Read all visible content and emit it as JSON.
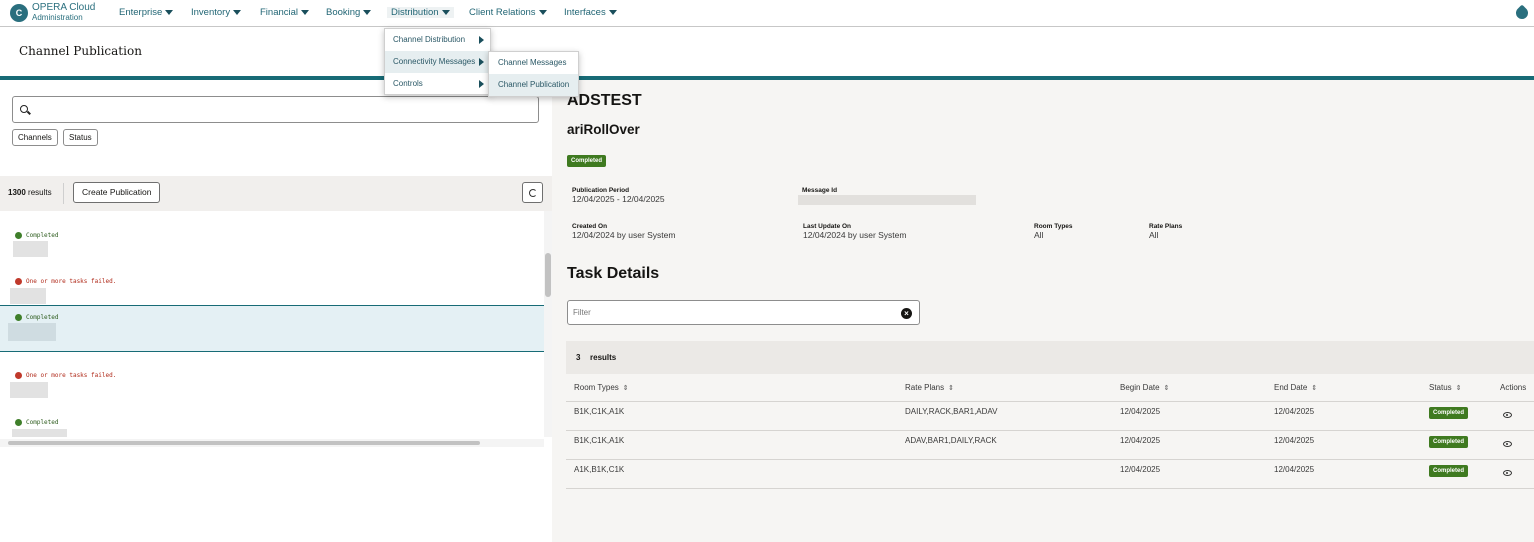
{
  "brand": {
    "line1": "OPERA Cloud",
    "line2": "Administration"
  },
  "nav": [
    {
      "label": "Enterprise"
    },
    {
      "label": "Inventory"
    },
    {
      "label": "Financial"
    },
    {
      "label": "Booking"
    },
    {
      "label": "Distribution"
    },
    {
      "label": "Client Relations"
    },
    {
      "label": "Interfaces"
    }
  ],
  "menu_distribution": [
    "Channel Distribution",
    "Connectivity Messages",
    "Controls"
  ],
  "menu_connectivity": [
    "Channel Messages",
    "Channel Publication"
  ],
  "page_title": "Channel Publication",
  "left": {
    "chips": [
      "Channels",
      "Status"
    ],
    "results_count": "1300",
    "results_label": "results",
    "create_button": "Create Publication",
    "items": [
      {
        "status": "Completed",
        "state": "ok"
      },
      {
        "status": "One or more tasks failed.",
        "state": "err"
      },
      {
        "status": "Completed",
        "state": "ok"
      },
      {
        "status": "One or more tasks failed.",
        "state": "err"
      },
      {
        "status": "Completed",
        "state": "ok"
      }
    ]
  },
  "detail": {
    "title": "ADSTEST",
    "subtitle": "ariRollOver",
    "status": "Completed",
    "publication_period_label": "Publication Period",
    "publication_period": "12/04/2025 - 12/04/2025",
    "message_id_label": "Message Id",
    "created_on_label": "Created On",
    "created_on": "12/04/2024 by user System",
    "last_update_label": "Last Update On",
    "last_update": "12/04/2024 by user System",
    "room_types_label": "Room Types",
    "room_types": "All",
    "rate_plans_label": "Rate Plans",
    "rate_plans": "All"
  },
  "tasks": {
    "heading": "Task Details",
    "filter_placeholder": "Filter",
    "count": "3",
    "results_label": "results",
    "columns": [
      "Room Types",
      "Rate Plans",
      "Begin Date",
      "End Date",
      "Status",
      "Actions"
    ],
    "rows": [
      {
        "room_types": "B1K,C1K,A1K",
        "rate_plans": "DAILY,RACK,BAR1,ADAV",
        "begin": "12/04/2025",
        "end": "12/04/2025",
        "status": "Completed"
      },
      {
        "room_types": "B1K,C1K,A1K",
        "rate_plans": "ADAV,BAR1,DAILY,RACK",
        "begin": "12/04/2025",
        "end": "12/04/2025",
        "status": "Completed"
      },
      {
        "room_types": "A1K,B1K,C1K",
        "rate_plans": "",
        "begin": "12/04/2025",
        "end": "12/04/2025",
        "status": "Completed"
      }
    ]
  },
  "colors": {
    "teal": "#176b76",
    "nav_text": "#226675",
    "success": "#3f7a20",
    "error": "#b02a1a"
  },
  "icons": [
    "opera-logo-icon",
    "chevron-down-icon",
    "chevron-right-icon",
    "search-icon",
    "refresh-icon",
    "check-circle-icon",
    "error-circle-icon",
    "clear-icon",
    "sort-icon",
    "view-eye-icon",
    "help-icon"
  ]
}
